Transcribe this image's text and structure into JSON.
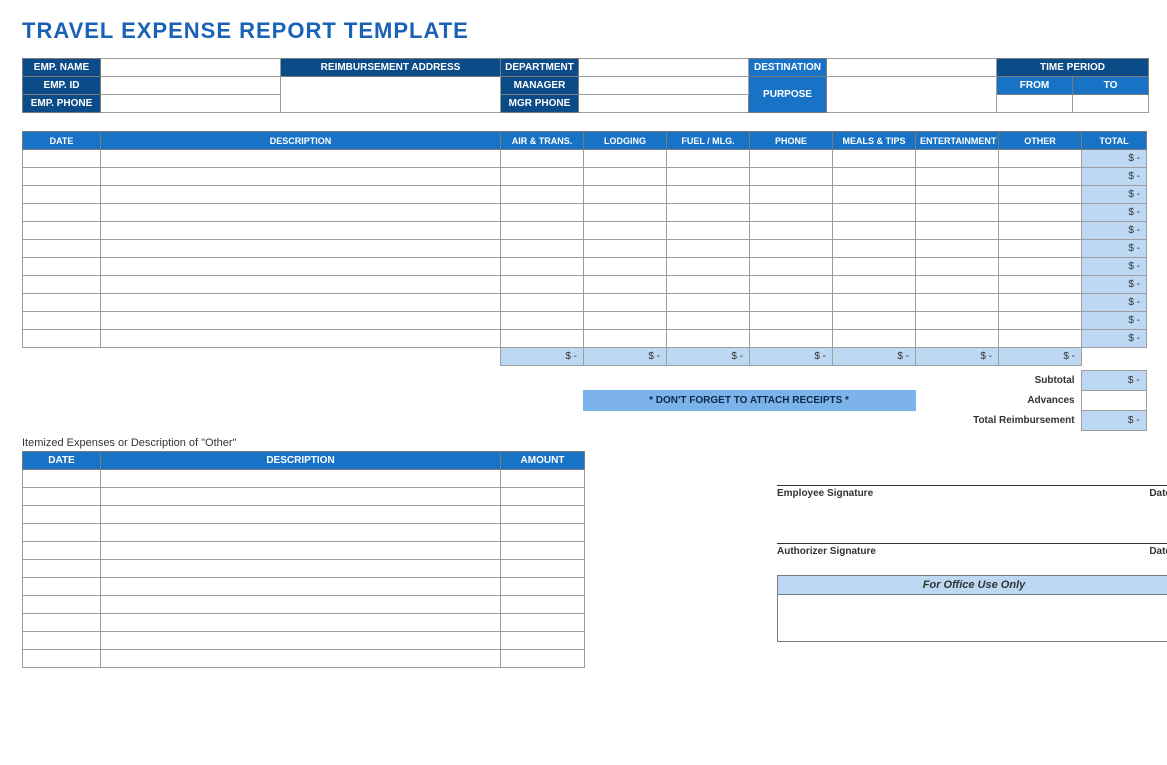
{
  "title": "TRAVEL EXPENSE REPORT TEMPLATE",
  "info": {
    "emp_name_label": "EMP. NAME",
    "emp_id_label": "EMP. ID",
    "emp_phone_label": "EMP. PHONE",
    "reimb_addr_label": "REIMBURSEMENT ADDRESS",
    "department_label": "DEPARTMENT",
    "manager_label": "MANAGER",
    "mgr_phone_label": "MGR PHONE",
    "destination_label": "DESTINATION",
    "purpose_label": "PURPOSE",
    "time_period_label": "TIME PERIOD",
    "from_label": "FROM",
    "to_label": "TO"
  },
  "main": {
    "cols": {
      "date": "DATE",
      "description": "DESCRIPTION",
      "air": "AIR & TRANS.",
      "lodging": "LODGING",
      "fuel": "FUEL / MLG.",
      "phone": "PHONE",
      "meals": "MEALS & TIPS",
      "ent": "ENTERTAINMENT",
      "other": "OTHER",
      "total": "TOTAL"
    },
    "total_placeholder": "$            -",
    "col_total_placeholder": "$               -",
    "row_count": 11
  },
  "summary": {
    "reminder": "* DON'T FORGET TO ATTACH RECEIPTS *",
    "subtotal_label": "Subtotal",
    "advances_label": "Advances",
    "total_reimb_label": "Total Reimbursement",
    "amount_placeholder": "$            -"
  },
  "itemized": {
    "caption": "Itemized Expenses or Description of \"Other\"",
    "cols": {
      "date": "DATE",
      "description": "DESCRIPTION",
      "amount": "AMOUNT"
    },
    "row_count": 11
  },
  "signatures": {
    "employee": "Employee Signature",
    "authorizer": "Authorizer Signature",
    "date": "Date"
  },
  "office": {
    "title": "For Office Use Only"
  }
}
